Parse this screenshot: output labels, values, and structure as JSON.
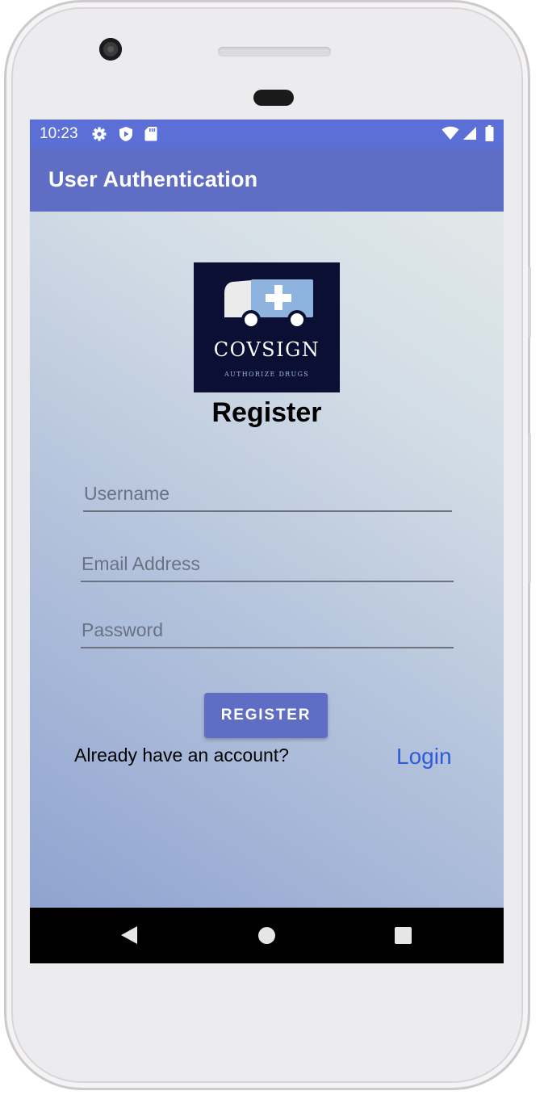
{
  "status_bar": {
    "time": "10:23",
    "left_icons": [
      "gear-icon",
      "shield-play-icon",
      "sd-card-icon"
    ],
    "right_icons": [
      "wifi-icon",
      "cell-signal-icon",
      "battery-icon"
    ]
  },
  "app_bar": {
    "title": "User Authentication"
  },
  "logo": {
    "brand": "COVSIGN",
    "tagline": "AUTHORIZE DRUGS"
  },
  "form": {
    "heading": "Register",
    "username_placeholder": "Username",
    "email_placeholder": "Email Address",
    "password_placeholder": "Password",
    "register_label": "REGISTER",
    "already_text": "Already have an account?",
    "login_label": "Login"
  },
  "nav_bar": {
    "icons": [
      "back-icon",
      "home-icon",
      "recents-icon"
    ]
  },
  "colors": {
    "status_bar": "#5c6fd6",
    "app_bar": "#5f6dc4",
    "button": "#5f6dc4",
    "link": "#2e5bd9",
    "logo_bg": "#0b0f33"
  }
}
